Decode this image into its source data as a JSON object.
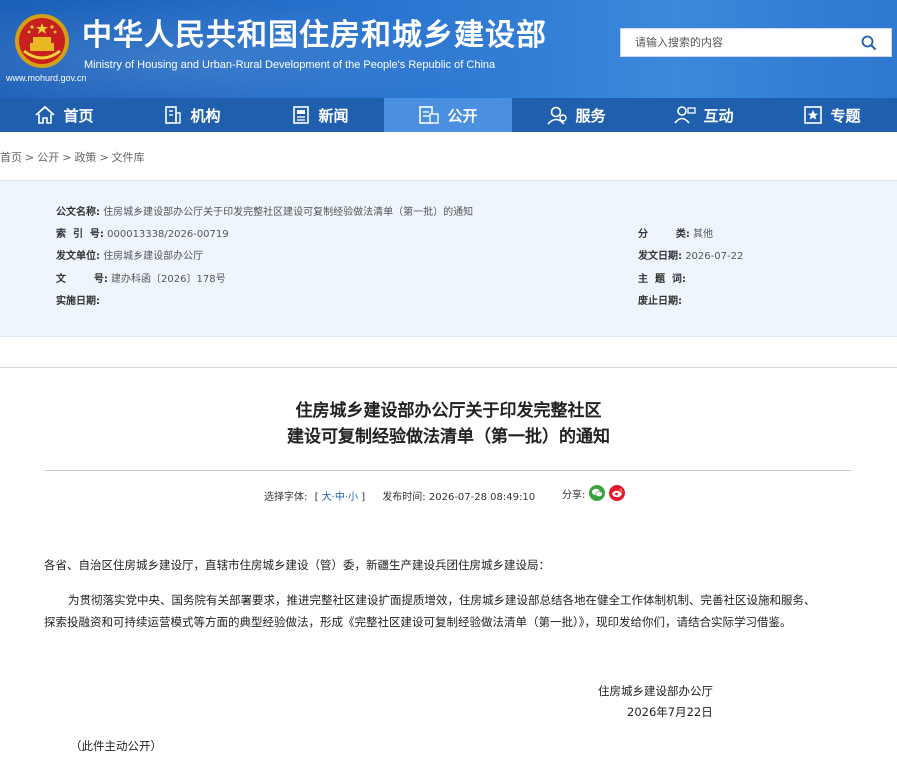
{
  "header": {
    "site_url": "www.mohurd.gov.cn",
    "title": "中华人民共和国住房和城乡建设部",
    "subtitle": "Ministry of Housing and Urban-Rural Development of the People's Republic of China",
    "search_placeholder": "请输入搜索的内容",
    "colors": {
      "header_blue": "#2a75d0",
      "nav_blue": "#1f5fae",
      "nav_active": "#4a8fe0"
    }
  },
  "nav": [
    {
      "label": "首页",
      "icon": "home-icon"
    },
    {
      "label": "机构",
      "icon": "building-icon"
    },
    {
      "label": "新闻",
      "icon": "newspaper-icon"
    },
    {
      "label": "公开",
      "icon": "document-icon",
      "active": true
    },
    {
      "label": "服务",
      "icon": "user-service-icon"
    },
    {
      "label": "互动",
      "icon": "people-chat-icon"
    },
    {
      "label": "专题",
      "icon": "star-icon"
    }
  ],
  "breadcrumb": [
    "首页",
    "公开",
    "政策",
    "文件库"
  ],
  "meta": {
    "doc_name_label": "公文名称:",
    "doc_name": "住房城乡建设部办公厅关于印发完整社区建设可复制经验做法清单（第一批）的通知",
    "index_label": "索  引  号:",
    "index_value": "000013338/2026-00719",
    "issuer_label": "发文单位:",
    "issuer_value": "住房城乡建设部办公厅",
    "docno_label": "文        号:",
    "docno_value": "建办科函〔2026〕178号",
    "impl_label": "实施日期:",
    "impl_value": "",
    "category_label": "分        类:",
    "category_value": "其他",
    "issue_date_label": "发文日期:",
    "issue_date_value": "2026-07-22",
    "subject_label": "主  题  词:",
    "subject_value": "",
    "abolish_label": "废止日期:",
    "abolish_value": ""
  },
  "article": {
    "title_line1": "住房城乡建设部办公厅关于印发完整社区",
    "title_line2": "建设可复制经验做法清单（第一批）的通知",
    "font_select_label": "选择字体:",
    "font_open": "[",
    "font_large": "大",
    "font_mid": "中",
    "font_small": "小",
    "font_close": "]",
    "font_sep": "·",
    "publish_label": "发布时间:",
    "publish_time": "2026-07-28 08:49:10",
    "share_label": "分享:",
    "addressee": "各省、自治区住房城乡建设厅，直辖市住房城乡建设（管）委，新疆生产建设兵团住房城乡建设局：",
    "para1_line1": "为贯彻落实党中央、国务院有关部署要求，推进完整社区建设扩面提质增效，住房城乡建设部总结各地在健全工作体制机制、完善社区设施和服务、",
    "para1_line2": "探索投融资和可持续运营模式等方面的典型经验做法，形成《完整社区建设可复制经验做法清单（第一批）》，现印发给你们，请结合实际学习借鉴。",
    "signature": "住房城乡建设部办公厅",
    "sign_date": "2026年7月22日",
    "public_note": "（此件主动公开）"
  }
}
